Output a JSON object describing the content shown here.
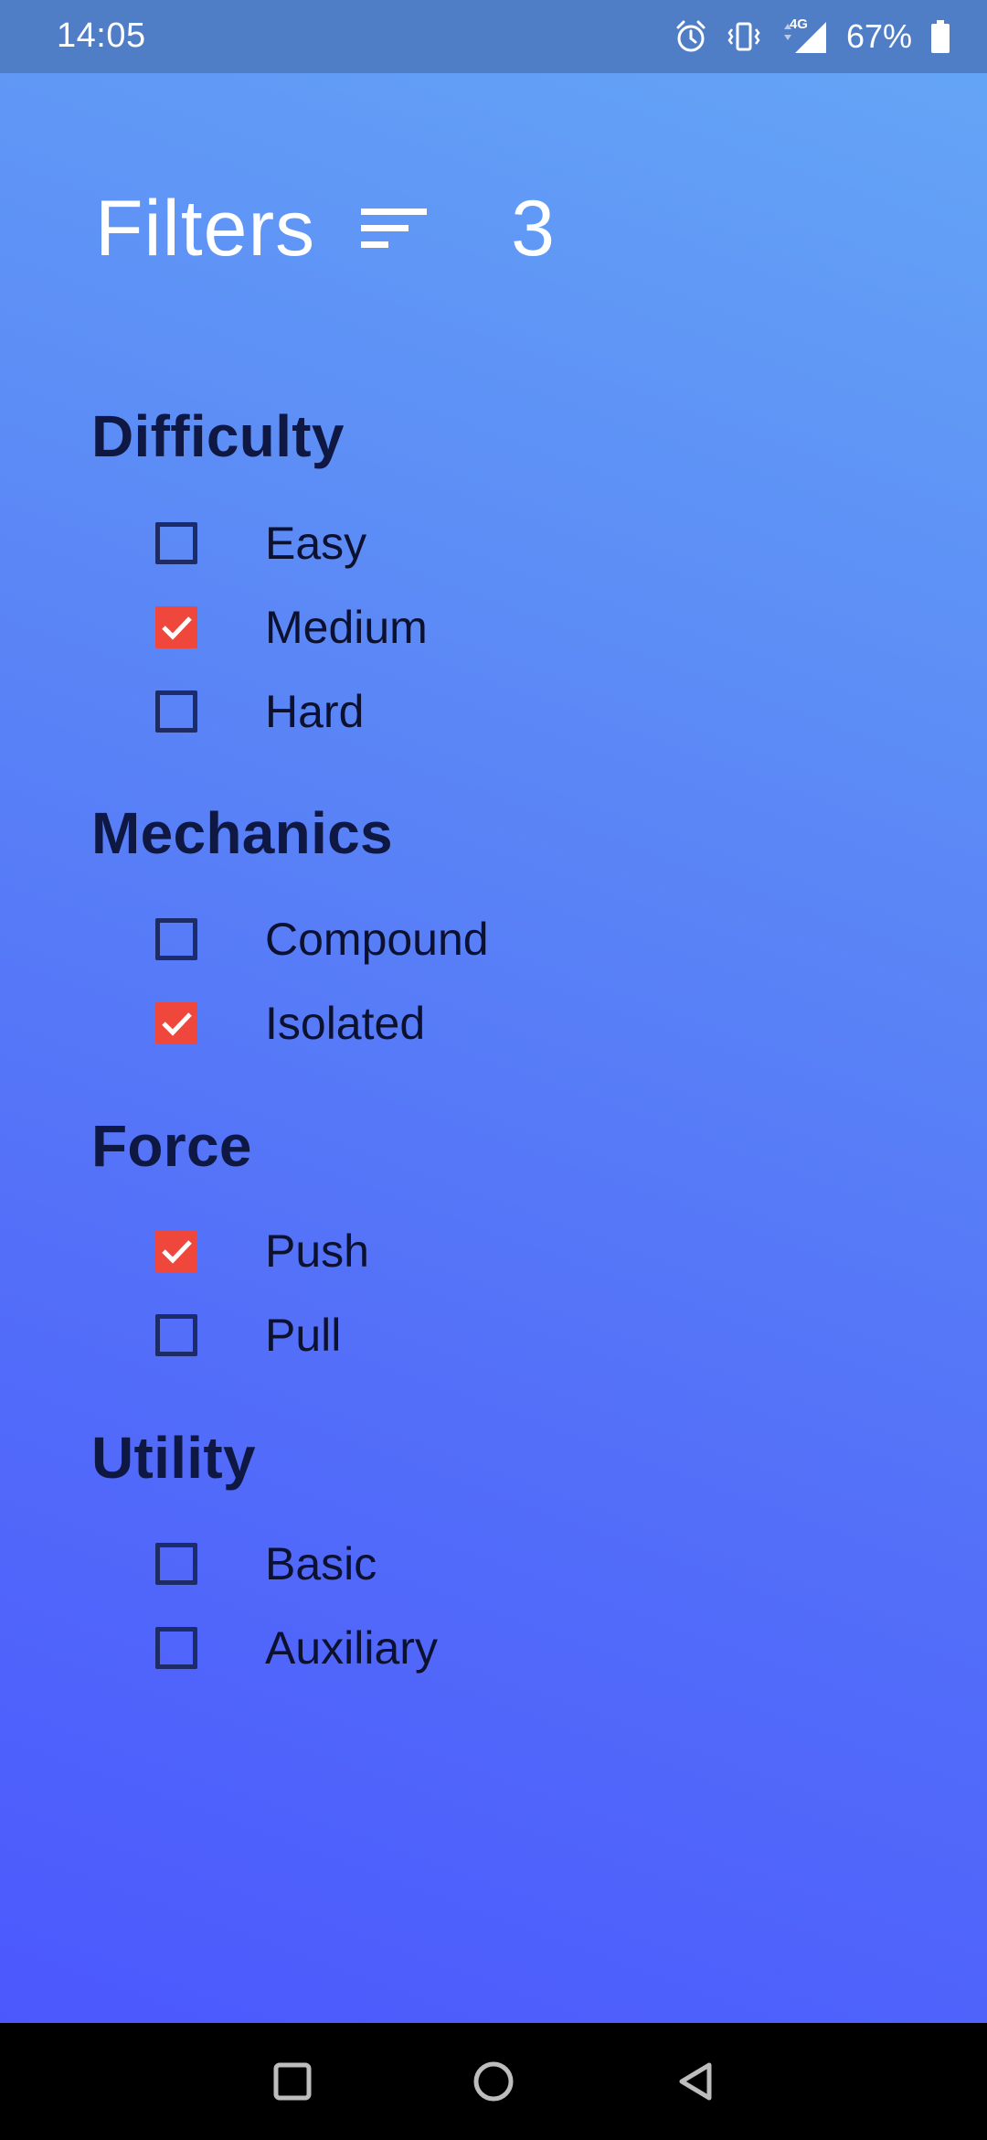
{
  "status_bar": {
    "time": "14:05",
    "network": "4G",
    "battery": "67%"
  },
  "header": {
    "title": "Filters",
    "count": "3"
  },
  "sections": [
    {
      "title": "Difficulty",
      "options": [
        {
          "label": "Easy",
          "checked": false
        },
        {
          "label": "Medium",
          "checked": true
        },
        {
          "label": "Hard",
          "checked": false
        }
      ]
    },
    {
      "title": "Mechanics",
      "options": [
        {
          "label": "Compound",
          "checked": false
        },
        {
          "label": "Isolated",
          "checked": true
        }
      ]
    },
    {
      "title": "Force",
      "options": [
        {
          "label": "Push",
          "checked": true
        },
        {
          "label": "Pull",
          "checked": false
        }
      ]
    },
    {
      "title": "Utility",
      "options": [
        {
          "label": "Basic",
          "checked": false
        },
        {
          "label": "Auxiliary",
          "checked": false
        }
      ]
    }
  ],
  "colors": {
    "checked": "#f0473c",
    "section_title": "#0f1842"
  },
  "icons": {
    "header": "sort-icon",
    "status": [
      "alarm-icon",
      "vibrate-icon",
      "signal-icon",
      "battery-icon"
    ],
    "nav": [
      "recents-icon",
      "home-icon",
      "back-icon"
    ]
  }
}
